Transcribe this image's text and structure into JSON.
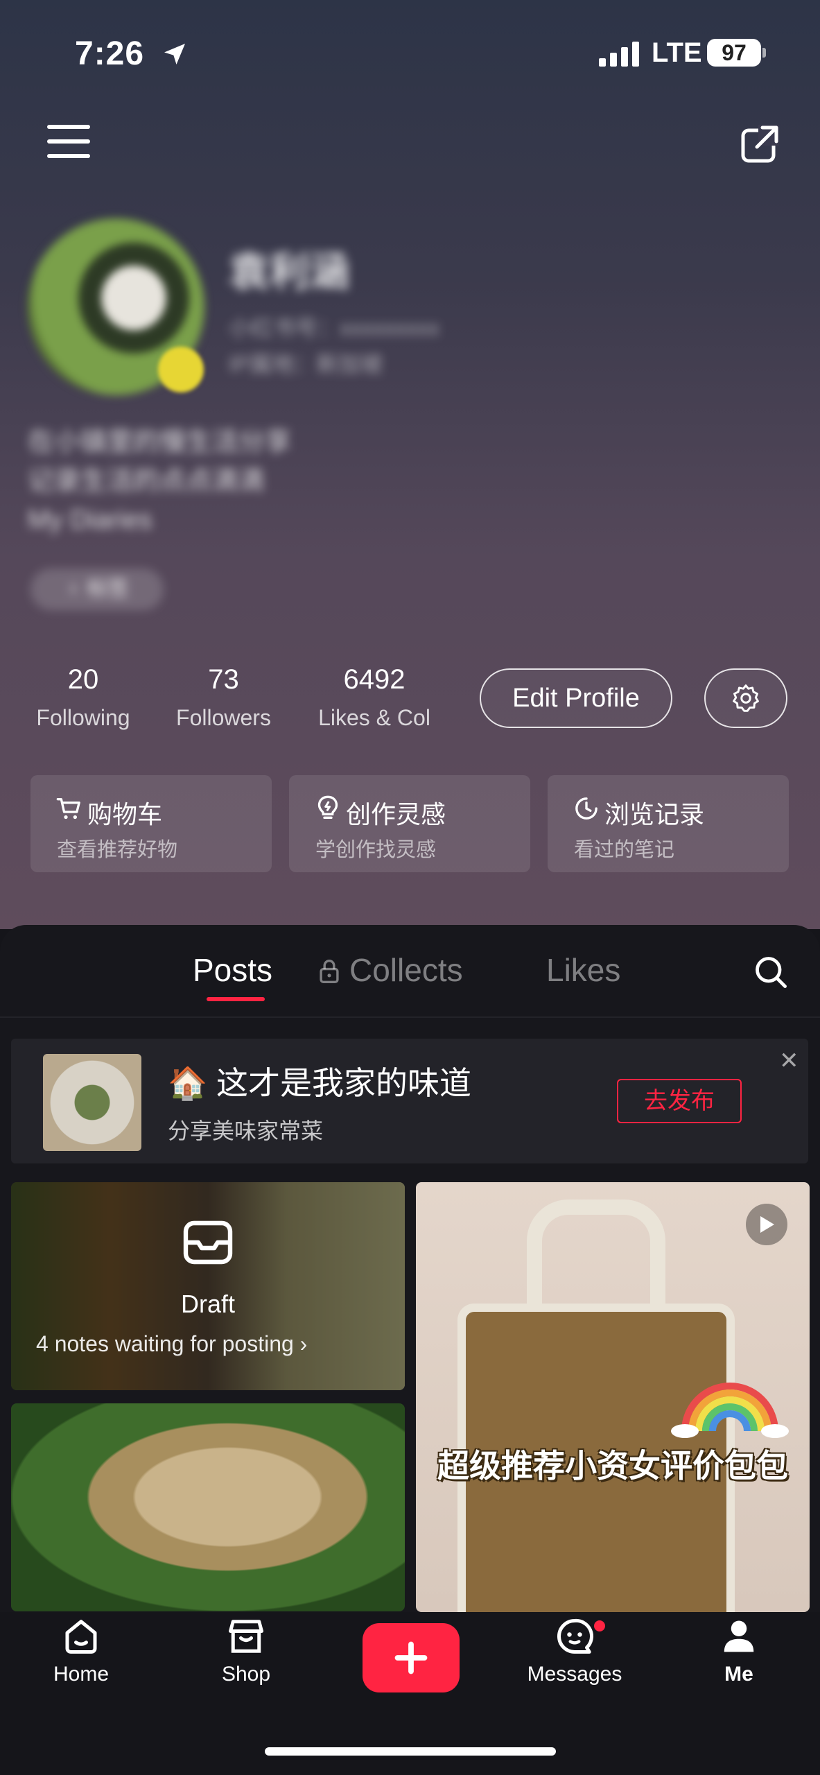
{
  "status_bar": {
    "time": "7:26",
    "network": "LTE",
    "battery": "97"
  },
  "profile": {
    "username": "袁利涵",
    "id_line": "小红书号：xxxxxxxxx",
    "ip_line": "IP属地：新加坡",
    "bio_lines": [
      "在小镇里的慢生活分享",
      "记录生活的点点滴滴",
      "My Diaries"
    ],
    "tag": "♀ 标签"
  },
  "stats": [
    {
      "value": "20",
      "label": "Following"
    },
    {
      "value": "73",
      "label": "Followers"
    },
    {
      "value": "6492",
      "label": "Likes & Col"
    }
  ],
  "buttons": {
    "edit_profile": "Edit Profile"
  },
  "quick_cards": [
    {
      "title": "购物车",
      "subtitle": "查看推荐好物",
      "icon": "cart-icon"
    },
    {
      "title": "创作灵感",
      "subtitle": "学创作找灵感",
      "icon": "bulb-icon"
    },
    {
      "title": "浏览记录",
      "subtitle": "看过的笔记",
      "icon": "clock-icon"
    }
  ],
  "tabs": [
    {
      "label": "Posts",
      "active": true
    },
    {
      "label": "Collects",
      "locked": true
    },
    {
      "label": "Likes"
    }
  ],
  "promo": {
    "title": "🏠 这才是我家的味道",
    "subtitle": "分享美味家常菜",
    "button": "去发布",
    "close": "✕"
  },
  "draft": {
    "title": "Draft",
    "subtitle": "4 notes waiting for posting ›"
  },
  "posts": [
    {
      "overlay_text": "超级推荐小资女评价包包",
      "is_video": true
    }
  ],
  "bottom_nav": [
    {
      "label": "Home"
    },
    {
      "label": "Shop"
    },
    {
      "label": "Messages",
      "badge": true
    },
    {
      "label": "Me",
      "active": true
    }
  ],
  "colors": {
    "accent": "#ff2442",
    "panel_bg": "#17171c"
  }
}
